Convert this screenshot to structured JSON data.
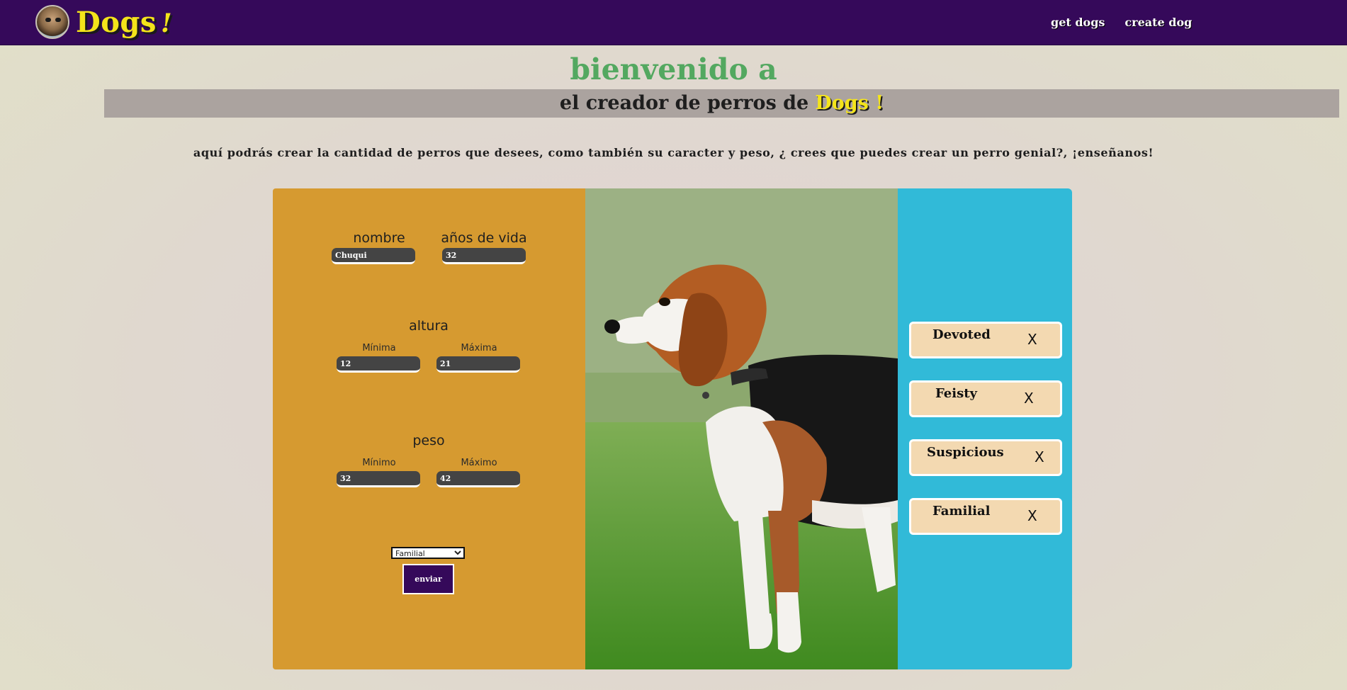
{
  "brand": {
    "name": "Dogs",
    "mark": "!"
  },
  "nav": {
    "links": [
      "get dogs",
      "create dog"
    ]
  },
  "heading": {
    "welcome": "bienvenido a",
    "banner": "el creador de perros de",
    "banner_brand": "Dogs !",
    "intro": "aquí podrás crear la cantidad de perros que desees, como también su caracter y peso, ¿ crees que puedes crear un perro genial?, ¡enseñanos!"
  },
  "form": {
    "name_label": "nombre",
    "name_value": "Chuqui",
    "life_label": "años de vida",
    "life_value": "32",
    "height_label": "altura",
    "height_min_label": "Mínima",
    "height_min_value": "12",
    "height_max_label": "Máxima",
    "height_max_value": "21",
    "weight_label": "peso",
    "weight_min_label": "Mínimo",
    "weight_min_value": "32",
    "weight_max_label": "Máximo",
    "weight_max_value": "42",
    "temperament_selected": "Familial",
    "submit_label": "enviar"
  },
  "temperaments": [
    {
      "name": "Devoted",
      "remove": "X"
    },
    {
      "name": "Feisty",
      "remove": "X"
    },
    {
      "name": "Suspicious",
      "remove": "X"
    },
    {
      "name": "Familial",
      "remove": "X"
    }
  ],
  "colors": {
    "nav_bg": "#35095a",
    "brand_yellow": "#f4e41a",
    "welcome_green": "#53a860",
    "banner_gray": "#aba39f",
    "form_orange": "#d69a30",
    "temperament_blue": "#31bad8",
    "chip_bg": "#f3d9b1"
  }
}
